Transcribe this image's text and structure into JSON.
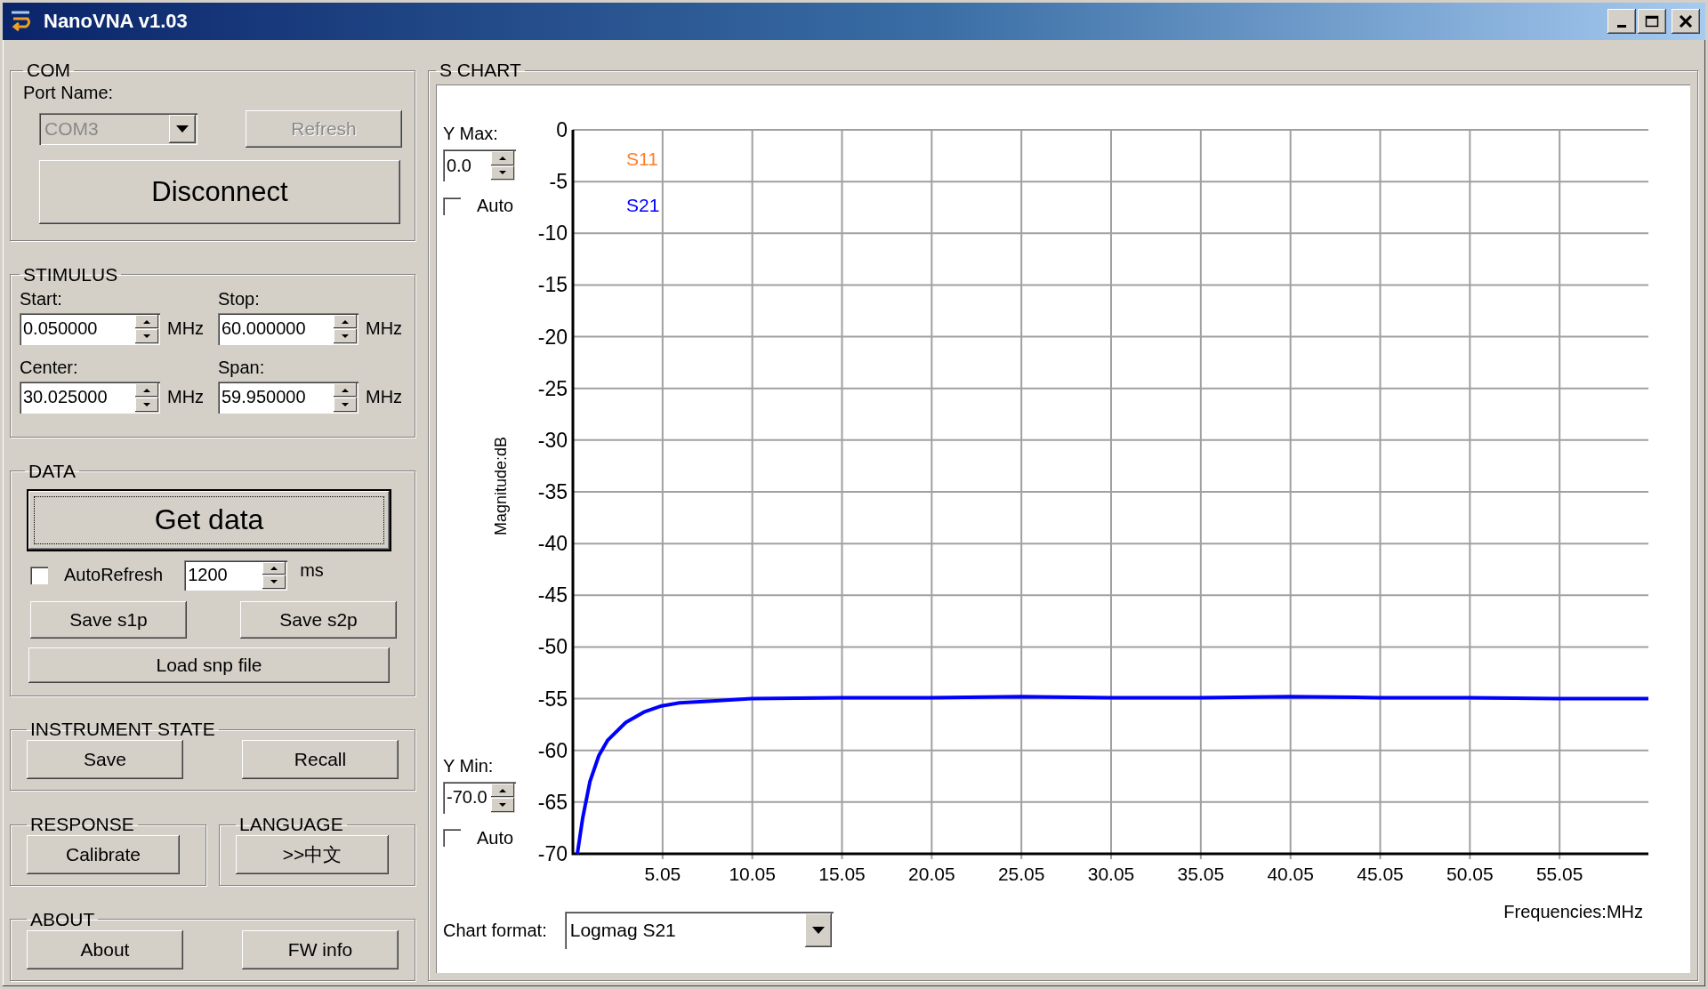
{
  "window": {
    "title": "NanoVNA v1.03"
  },
  "com": {
    "title": "COM",
    "port_label": "Port Name:",
    "port": {
      "value": "COM3",
      "disabled": true
    },
    "refresh": {
      "label": "Refresh",
      "disabled": true
    },
    "connect_button": "Disconnect"
  },
  "stimulus": {
    "title": "STIMULUS",
    "fields": [
      {
        "label": "Start:",
        "value": "0.050000",
        "unit": "MHz"
      },
      {
        "label": "Stop:",
        "value": "60.000000",
        "unit": "MHz"
      },
      {
        "label": "Center:",
        "value": "30.025000",
        "unit": "MHz"
      },
      {
        "label": "Span:",
        "value": "59.950000",
        "unit": "MHz"
      }
    ]
  },
  "data": {
    "title": "DATA",
    "get_data": {
      "label": "Get data",
      "focused": true
    },
    "auto_refresh": {
      "label": "AutoRefresh",
      "checked": false
    },
    "interval": {
      "value": "1200",
      "unit": "ms"
    },
    "save_buttons": [
      "Save s1p",
      "Save s2p"
    ],
    "load_button": "Load snp file"
  },
  "instrument_state": {
    "title": "INSTRUMENT STATE",
    "buttons": [
      "Save",
      "Recall"
    ]
  },
  "response": {
    "title": "RESPONSE",
    "buttons": [
      "Calibrate"
    ]
  },
  "language": {
    "title": "LANGUAGE",
    "buttons": [
      ">>中文"
    ]
  },
  "about": {
    "title": "ABOUT",
    "buttons": [
      "About",
      "FW info"
    ]
  },
  "s_chart": {
    "title": "S CHART",
    "y_max": {
      "label": "Y Max:",
      "value": "0.0",
      "auto": {
        "label": "Auto",
        "checked": false
      }
    },
    "y_min": {
      "label": "Y Min:",
      "value": "-70.0",
      "auto": {
        "label": "Auto",
        "checked": false
      }
    },
    "chart_format": {
      "label": "Chart format:",
      "value": "Logmag S21"
    },
    "chart_data": {
      "type": "line",
      "grid": true,
      "xlabel": "Frequencies:MHz",
      "ylabel": "Magnitude:dB",
      "x": [
        0.3,
        0.6,
        1,
        1.5,
        2,
        3,
        4,
        5,
        6,
        8,
        10,
        15,
        20,
        25,
        30,
        35,
        40,
        45,
        50,
        55,
        60
      ],
      "series": [
        {
          "name": "S11",
          "color": "#ff7f27",
          "values": [
            null,
            null,
            null,
            null,
            null,
            null,
            null,
            null,
            null,
            null,
            null,
            null,
            null,
            null,
            null,
            null,
            null,
            null,
            null,
            null,
            null
          ]
        },
        {
          "name": "S21",
          "color": "#0000ff",
          "values": [
            -70,
            -66.5,
            -63,
            -60.5,
            -59,
            -57.3,
            -56.3,
            -55.7,
            -55.4,
            -55.2,
            -55,
            -54.9,
            -54.9,
            -54.8,
            -54.9,
            -54.9,
            -54.8,
            -54.9,
            -54.9,
            -55,
            -55
          ]
        }
      ],
      "xlim": [
        0.05,
        60
      ],
      "ylim": [
        -70,
        0
      ],
      "xticks": [
        5.05,
        10.05,
        15.05,
        20.05,
        25.05,
        30.05,
        35.05,
        40.05,
        45.05,
        50.05,
        55.05
      ],
      "yticks": [
        0,
        -5,
        -10,
        -15,
        -20,
        -25,
        -30,
        -35,
        -40,
        -45,
        -50,
        -55,
        -60,
        -65,
        -70
      ]
    }
  }
}
